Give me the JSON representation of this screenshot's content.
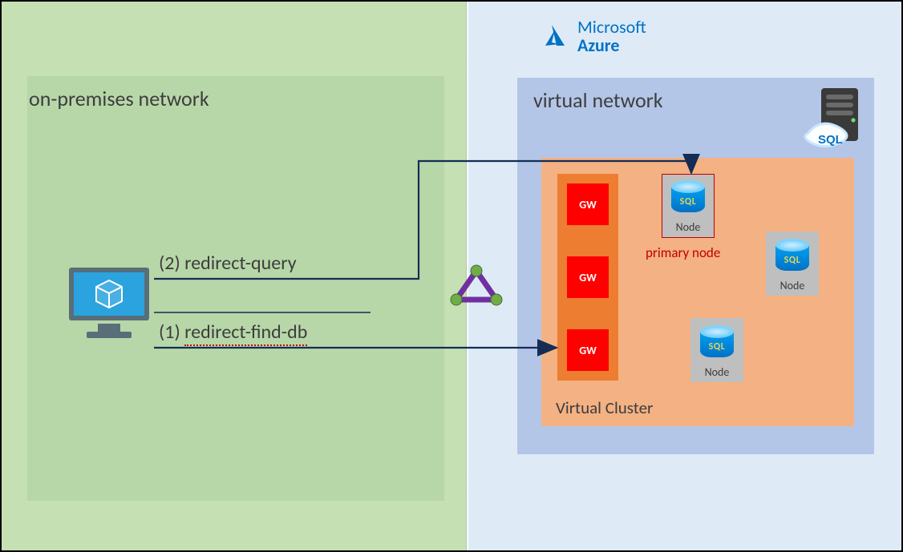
{
  "onprem": {
    "title": "on-premises network"
  },
  "azure_brand": {
    "line1": "Microsoft",
    "line2": "Azure"
  },
  "vnet": {
    "title": "virtual network"
  },
  "vcluster": {
    "label": "Virtual Cluster"
  },
  "gw": {
    "label": "GW",
    "items": [
      "GW",
      "GW",
      "GW"
    ]
  },
  "nodes": {
    "caption": "Node",
    "sql_label": "SQL",
    "primary_caption": "primary node"
  },
  "connections": {
    "redirect_query": "(2) redirect-query",
    "redirect_find_db_prefix": "(1) ",
    "redirect_find_db": "redirect-find-db"
  },
  "glyphs": {
    "monitor": "client-computer",
    "lb": "load-balancer",
    "sql_server": "sql-managed-instance"
  }
}
